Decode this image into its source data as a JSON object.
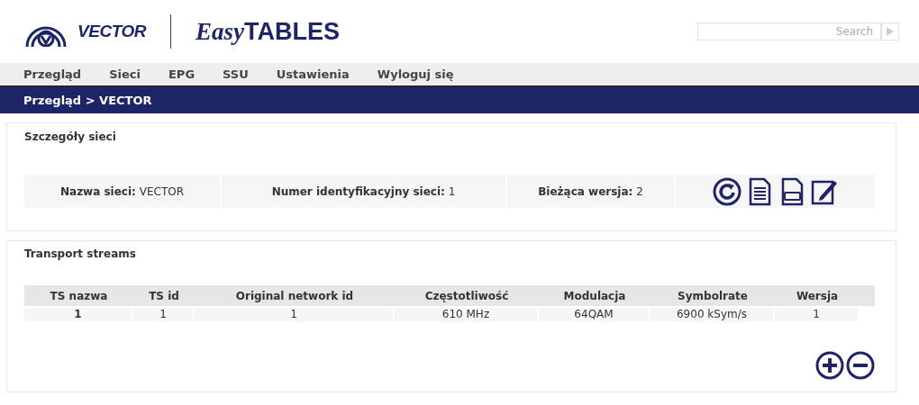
{
  "header": {
    "brand": "VECTOR",
    "product_prefix": "Easy",
    "product": "TABLES",
    "search": {
      "placeholder": "Search"
    }
  },
  "menu": [
    "Przegląd",
    "Sieci",
    "EPG",
    "SSU",
    "Ustawienia",
    "Wyloguj się"
  ],
  "breadcrumb": "Przegląd > VECTOR",
  "network_panel": {
    "title": "Szczegóły sieci",
    "details": [
      "**Nazwa sieci:** VECTOR",
      "**Numer identyfikacyjny sieci:** 1",
      "**Bieżąca wersja:** 2"
    ]
  },
  "streams_panel": {
    "title": "Transport streams",
    "table": {
      "columns": [
        "TS nazwa",
        "TS id",
        "Original network id",
        "Częstotliwość",
        "Modulacja",
        "Symbolrate",
        "Wersja"
      ],
      "rows": [
        [
          "1",
          "1",
          "1",
          "610 MHz",
          "64QAM",
          "6900 kSym/s",
          "1"
        ]
      ]
    }
  }
}
